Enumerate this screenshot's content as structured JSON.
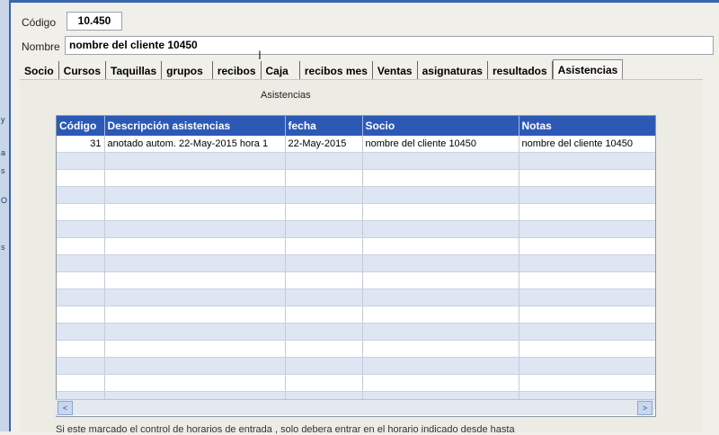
{
  "form": {
    "codigo_label": "Código",
    "codigo_value": "10.450",
    "nombre_label": "Nombre",
    "nombre_value": "nombre del cliente 10450"
  },
  "tabs": [
    "Socio",
    "Cursos",
    "Taquillas",
    "grupos",
    "recibos",
    "Caja",
    "recibos mes",
    "Ventas",
    "asignaturas",
    "resultados",
    "Asistencias"
  ],
  "active_tab": "Asistencias",
  "panel_title": "Asistencias",
  "grid": {
    "columns": [
      "Código",
      "Descripción asistencias",
      "fecha",
      "Socio",
      "Notas"
    ],
    "rows": [
      [
        "31",
        "anotado autom.  22-May-2015   hora 1",
        "22-May-2015",
        "nombre del cliente 10450",
        "nombre del cliente 10450"
      ]
    ]
  },
  "scroll": {
    "left_arrow": "<",
    "right_arrow": ">"
  },
  "footnote": "Si este marcado el control de horarios de entrada , solo debera entrar en el horario indicado desde hasta"
}
